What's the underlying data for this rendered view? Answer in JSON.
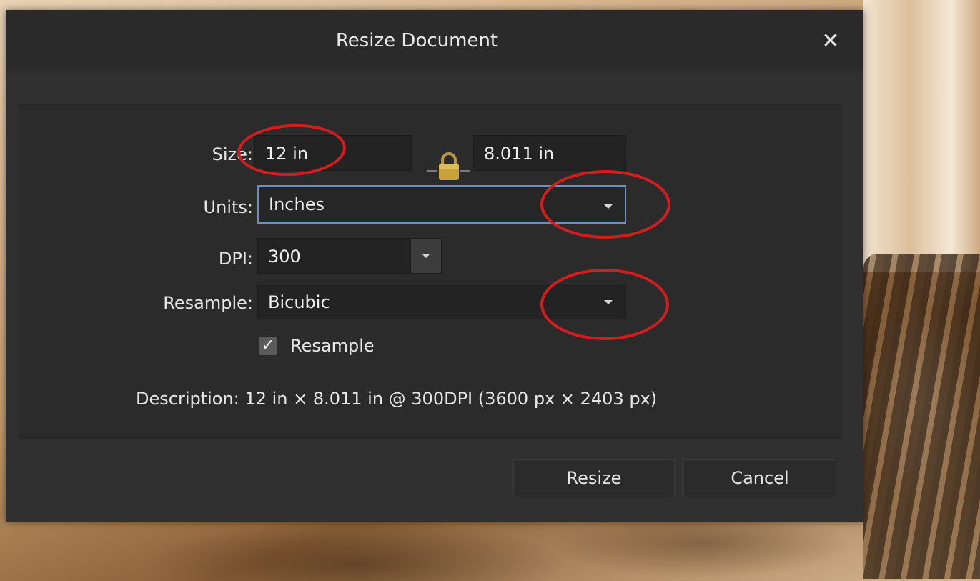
{
  "dialog": {
    "title": "Resize Document",
    "close_glyph": "✕",
    "size_label": "Size:",
    "width_value": "12 in",
    "height_value": "8.011 in",
    "lock_icon": "lock-icon",
    "units_label": "Units:",
    "units_value": "Inches",
    "dpi_label": "DPI:",
    "dpi_value": "300",
    "resample_label": "Resample:",
    "resample_value": "Bicubic",
    "resample_checkbox_label": "Resample",
    "resample_checked": true,
    "description": "Description: 12 in × 8.011 in @ 300DPI (3600 px × 2403 px)",
    "resize_button": "Resize",
    "cancel_button": "Cancel"
  },
  "colors": {
    "dialog_bg": "#303030",
    "panel_bg": "#2b2b2b",
    "field_bg": "#232323",
    "focus_border": "#6d8fbf",
    "annotation_red": "#d61c1c",
    "lock_gold": "#c9a13b"
  }
}
